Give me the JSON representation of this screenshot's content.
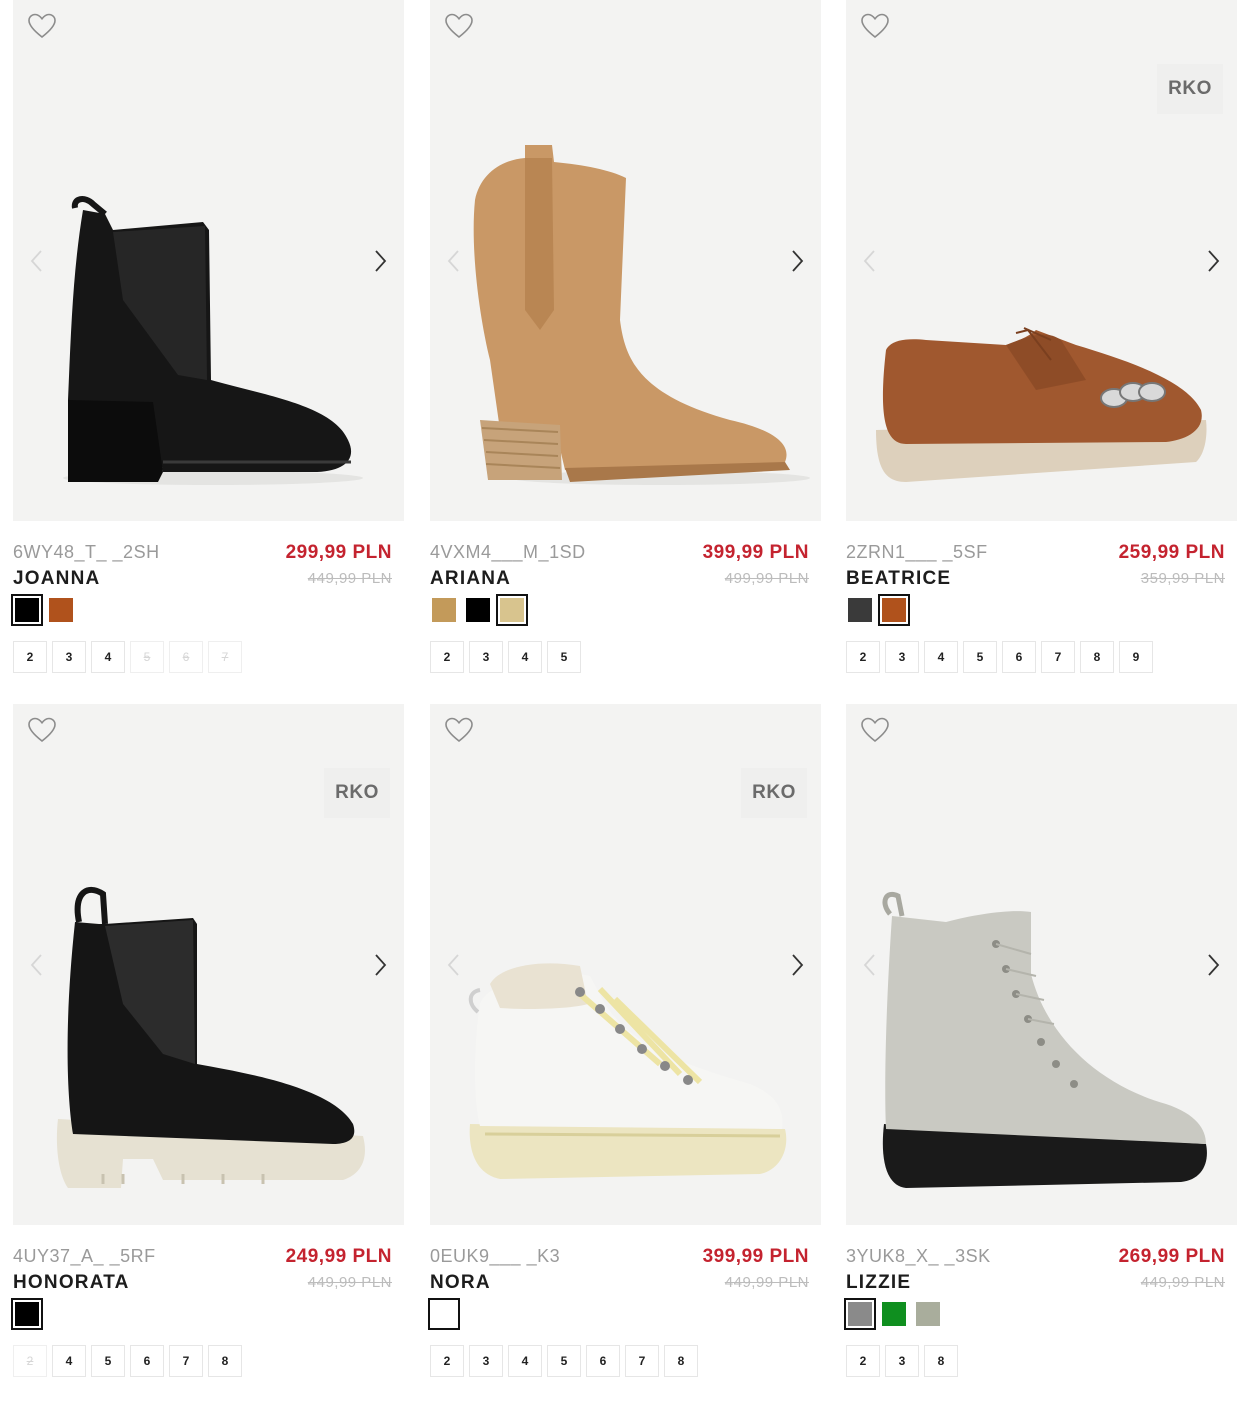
{
  "products": [
    {
      "sku": "6WY48_T_ _2SH",
      "name": "JOANNA",
      "price": "299,99 PLN",
      "old_price": "449,99 PLN",
      "badge": "",
      "shoe": "chelsea-heel",
      "colors": [
        "#000000",
        "#b0521c"
      ],
      "selected_color": 0,
      "sizes": [
        {
          "label": "2",
          "available": true
        },
        {
          "label": "3",
          "available": true
        },
        {
          "label": "4",
          "available": true
        },
        {
          "label": "5",
          "available": false
        },
        {
          "label": "6",
          "available": false
        },
        {
          "label": "7",
          "available": false
        }
      ]
    },
    {
      "sku": "4VXM4___M_1SD",
      "name": "ARIANA",
      "price": "399,99 PLN",
      "old_price": "499,99 PLN",
      "badge": "",
      "shoe": "western",
      "colors": [
        "#c39a5a",
        "#000000",
        "#d8c48e"
      ],
      "selected_color": 2,
      "sizes": [
        {
          "label": "2",
          "available": true
        },
        {
          "label": "3",
          "available": true
        },
        {
          "label": "4",
          "available": true
        },
        {
          "label": "5",
          "available": true
        }
      ]
    },
    {
      "sku": "2ZRN1___ _5SF",
      "name": "BEATRICE",
      "price": "259,99 PLN",
      "old_price": "359,99 PLN",
      "badge": "RKO",
      "shoe": "loafer",
      "colors": [
        "#3a3a3a",
        "#b0521c"
      ],
      "selected_color": 1,
      "sizes": [
        {
          "label": "2",
          "available": true
        },
        {
          "label": "3",
          "available": true
        },
        {
          "label": "4",
          "available": true
        },
        {
          "label": "5",
          "available": true
        },
        {
          "label": "6",
          "available": true
        },
        {
          "label": "7",
          "available": true
        },
        {
          "label": "8",
          "available": true
        },
        {
          "label": "9",
          "available": true
        }
      ]
    },
    {
      "sku": "4UY37_A_ _5RF",
      "name": "HONORATA",
      "price": "249,99 PLN",
      "old_price": "449,99 PLN",
      "badge": "RKO",
      "shoe": "chelsea-lug",
      "colors": [
        "#000000"
      ],
      "selected_color": 0,
      "sizes": [
        {
          "label": "2",
          "available": false
        },
        {
          "label": "4",
          "available": true
        },
        {
          "label": "5",
          "available": true
        },
        {
          "label": "6",
          "available": true
        },
        {
          "label": "7",
          "available": true
        },
        {
          "label": "8",
          "available": true
        }
      ]
    },
    {
      "sku": "0EUK9___ _K3",
      "name": "NORA",
      "price": "399,99 PLN",
      "old_price": "449,99 PLN",
      "badge": "RKO",
      "shoe": "hiker",
      "colors": [
        "#ffffff"
      ],
      "selected_color": 0,
      "sizes": [
        {
          "label": "2",
          "available": true
        },
        {
          "label": "3",
          "available": true
        },
        {
          "label": "4",
          "available": true
        },
        {
          "label": "5",
          "available": true
        },
        {
          "label": "6",
          "available": true
        },
        {
          "label": "7",
          "available": true
        },
        {
          "label": "8",
          "available": true
        }
      ]
    },
    {
      "sku": "3YUK8_X_ _3SK",
      "name": "LIZZIE",
      "price": "269,99 PLN",
      "old_price": "449,99 PLN",
      "badge": "",
      "shoe": "combat",
      "colors": [
        "#8a8a8a",
        "#0f8f1f",
        "#a9ad9c"
      ],
      "selected_color": 0,
      "sizes": [
        {
          "label": "2",
          "available": true
        },
        {
          "label": "3",
          "available": true
        },
        {
          "label": "8",
          "available": true
        }
      ]
    }
  ]
}
